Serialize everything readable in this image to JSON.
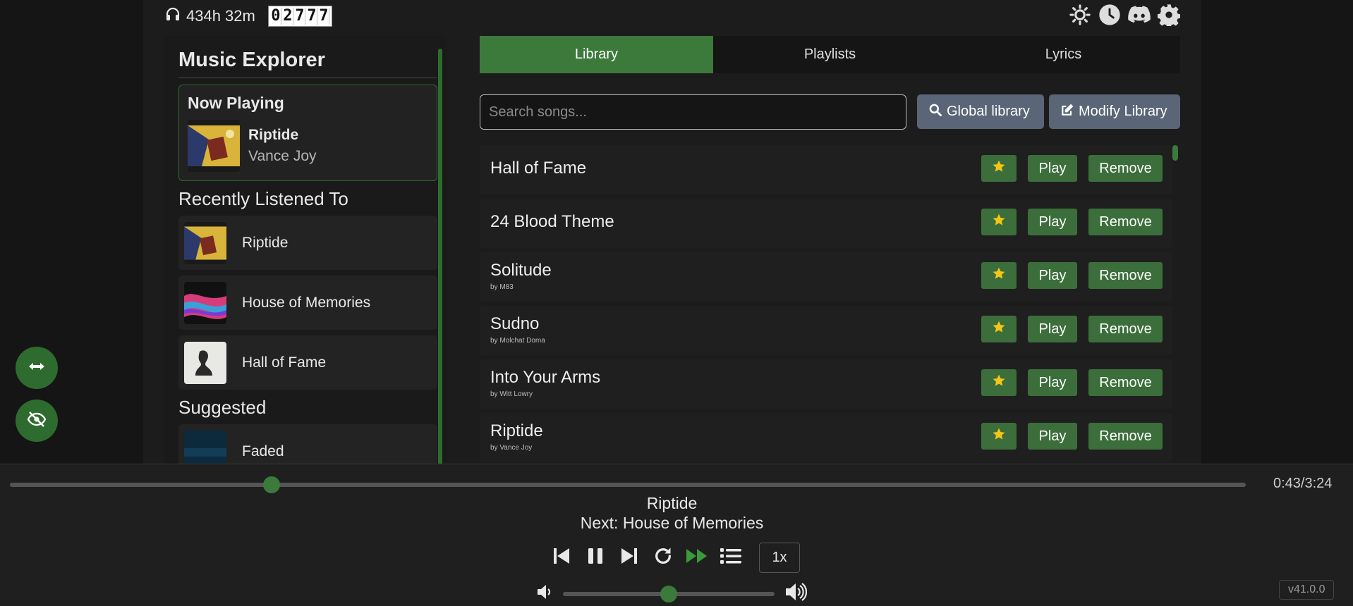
{
  "topbar": {
    "listen_time": "434h 32m",
    "counter": [
      "0",
      "2",
      "7",
      "7",
      "7"
    ],
    "icons": [
      "sun-icon",
      "clock-icon",
      "discord-icon",
      "gear-icon"
    ]
  },
  "float_buttons": [
    "resize-arrows-icon",
    "eye-slash-icon"
  ],
  "sidebar": {
    "title": "Music Explorer",
    "now_playing": {
      "label": "Now Playing",
      "song": "Riptide",
      "artist": "Vance Joy"
    },
    "recent_heading": "Recently Listened To",
    "recent": [
      {
        "title": "Riptide"
      },
      {
        "title": "House of Memories"
      },
      {
        "title": "Hall of Fame"
      }
    ],
    "suggested_heading": "Suggested",
    "suggested": [
      {
        "title": "Faded"
      }
    ]
  },
  "tabs": [
    {
      "label": "Library",
      "active": true
    },
    {
      "label": "Playlists",
      "active": false
    },
    {
      "label": "Lyrics",
      "active": false
    }
  ],
  "search": {
    "placeholder": "Search songs...",
    "value": ""
  },
  "buttons": {
    "global_library": "Global library",
    "modify_library": "Modify Library"
  },
  "song_actions": {
    "play": "Play",
    "remove": "Remove"
  },
  "songs": [
    {
      "title": "Hall of Fame",
      "artist": ""
    },
    {
      "title": "24 Blood Theme",
      "artist": ""
    },
    {
      "title": "Solitude",
      "artist": "by M83"
    },
    {
      "title": "Sudno",
      "artist": "by Molchat Doma"
    },
    {
      "title": "Into Your Arms",
      "artist": "by Witt Lowry"
    },
    {
      "title": "Riptide",
      "artist": "by Vance Joy"
    }
  ],
  "player": {
    "progress_fraction": 0.2115,
    "time": "0:43/3:24",
    "current": "Riptide",
    "next": "Next: House of Memories",
    "speed": "1x",
    "volume_fraction": 0.5,
    "version": "v41.0.0"
  },
  "colors": {
    "accent": "#3b7a3b",
    "star": "#f5c518",
    "grey_button": "#5a6577"
  }
}
